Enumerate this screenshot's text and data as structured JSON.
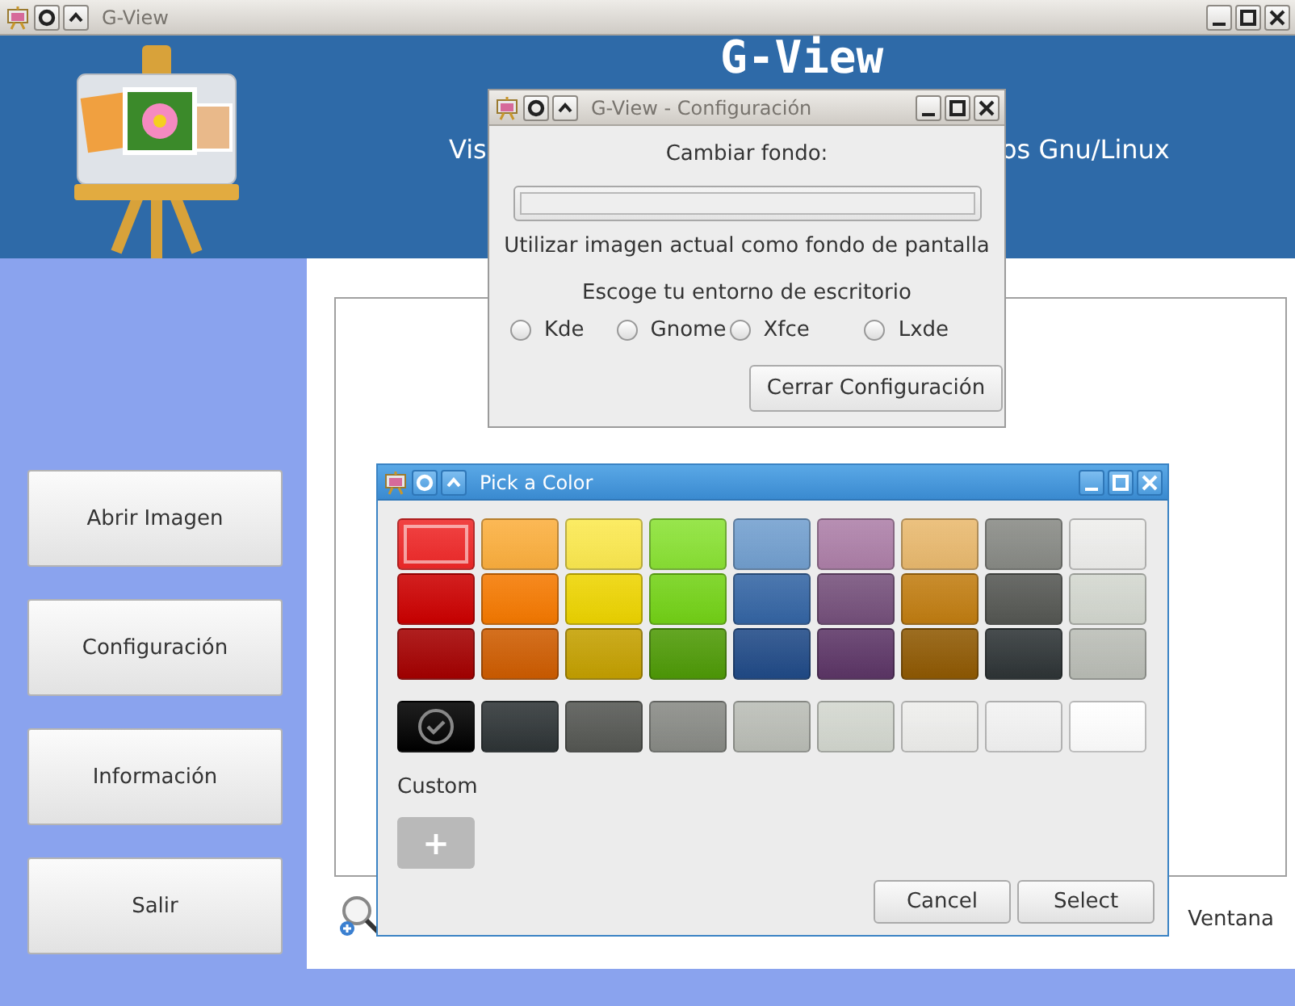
{
  "main_window": {
    "title": "G-View",
    "active": false,
    "header": {
      "title": "G-View",
      "subtitle_left": "Vis",
      "subtitle_right": "os Gnu/Linux"
    },
    "sidebar": {
      "buttons": [
        "Abrir Imagen",
        "Configuración",
        "Información",
        "Salir"
      ]
    },
    "footer": {
      "label": "Ventana"
    }
  },
  "config_dialog": {
    "title": "G-View - Configuración",
    "active": false,
    "change_label": "Cambiar fondo:",
    "use_current_label": "Utilizar imagen actual como fondo de pantalla",
    "desktop_label": "Escoge tu entorno de escritorio",
    "desktops": [
      {
        "label": "Kde",
        "selected": false
      },
      {
        "label": "Gnome",
        "selected": false
      },
      {
        "label": "Xfce",
        "selected": false
      },
      {
        "label": "Lxde",
        "selected": false
      }
    ],
    "close_button": "Cerrar Configuración"
  },
  "color_dialog": {
    "title": "Pick a Color",
    "active": true,
    "palette": [
      {
        "color": "#ef2929",
        "selected": false,
        "focused": true
      },
      {
        "color": "#fcaf3e",
        "selected": false,
        "focused": false
      },
      {
        "color": "#fce94f",
        "selected": false,
        "focused": false
      },
      {
        "color": "#8ae234",
        "selected": false,
        "focused": false
      },
      {
        "color": "#729fcf",
        "selected": false,
        "focused": false
      },
      {
        "color": "#ad7fa8",
        "selected": false,
        "focused": false
      },
      {
        "color": "#e9b96e",
        "selected": false,
        "focused": false
      },
      {
        "color": "#888a85",
        "selected": false,
        "focused": false
      },
      {
        "color": "#eeeeec",
        "selected": false,
        "focused": false
      },
      {
        "color": "#cc0000",
        "selected": false,
        "focused": false
      },
      {
        "color": "#f57900",
        "selected": false,
        "focused": false
      },
      {
        "color": "#edd400",
        "selected": false,
        "focused": false
      },
      {
        "color": "#73d216",
        "selected": false,
        "focused": false
      },
      {
        "color": "#3465a4",
        "selected": false,
        "focused": false
      },
      {
        "color": "#75507b",
        "selected": false,
        "focused": false
      },
      {
        "color": "#c17d11",
        "selected": false,
        "focused": false
      },
      {
        "color": "#555753",
        "selected": false,
        "focused": false
      },
      {
        "color": "#d3d7cf",
        "selected": false,
        "focused": false
      },
      {
        "color": "#a40000",
        "selected": false,
        "focused": false
      },
      {
        "color": "#ce5c00",
        "selected": false,
        "focused": false
      },
      {
        "color": "#c4a000",
        "selected": false,
        "focused": false
      },
      {
        "color": "#4e9a06",
        "selected": false,
        "focused": false
      },
      {
        "color": "#204a87",
        "selected": false,
        "focused": false
      },
      {
        "color": "#5c3566",
        "selected": false,
        "focused": false
      },
      {
        "color": "#8f5902",
        "selected": false,
        "focused": false
      },
      {
        "color": "#2e3436",
        "selected": false,
        "focused": false
      },
      {
        "color": "#babdb6",
        "selected": false,
        "focused": false
      }
    ],
    "greys": [
      {
        "color": "#000000",
        "selected": true
      },
      {
        "color": "#2e3436",
        "selected": false
      },
      {
        "color": "#555753",
        "selected": false
      },
      {
        "color": "#888a85",
        "selected": false
      },
      {
        "color": "#babdb6",
        "selected": false
      },
      {
        "color": "#d3d7cf",
        "selected": false
      },
      {
        "color": "#eeeeec",
        "selected": false
      },
      {
        "color": "#f3f3f3",
        "selected": false
      },
      {
        "color": "#ffffff",
        "selected": false
      }
    ],
    "custom_label": "Custom",
    "add_button": "+",
    "buttons": [
      "Cancel",
      "Select"
    ]
  }
}
